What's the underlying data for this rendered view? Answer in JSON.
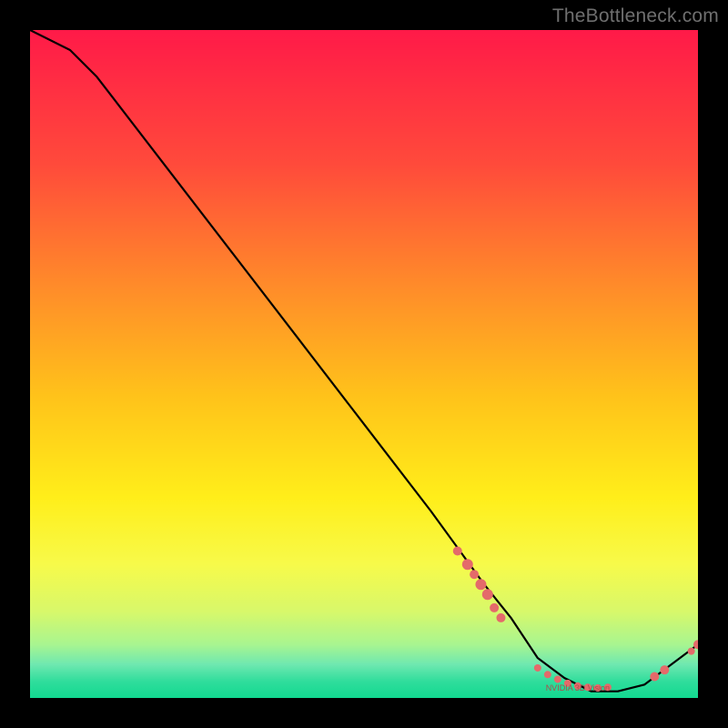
{
  "watermark": "TheBottleneck.com",
  "chart_data": {
    "type": "line",
    "title": "",
    "xlabel": "",
    "ylabel": "",
    "xlim": [
      0,
      100
    ],
    "ylim": [
      0,
      100
    ],
    "grid": false,
    "series": [
      {
        "name": "bottleneck-curve",
        "x": [
          0,
          6,
          10,
          20,
          30,
          40,
          50,
          60,
          68,
          72,
          76,
          80,
          84,
          88,
          92,
          96,
          100
        ],
        "values": [
          100,
          97,
          93,
          80,
          67,
          54,
          41,
          28,
          17,
          12,
          6,
          3,
          1,
          1,
          2,
          5,
          8
        ]
      }
    ],
    "markers": {
      "name": "highlighted-points",
      "color": "#e46a6a",
      "points": [
        {
          "x": 64.0,
          "y": 22.0,
          "r": 5
        },
        {
          "x": 65.5,
          "y": 20.0,
          "r": 6
        },
        {
          "x": 66.5,
          "y": 18.5,
          "r": 5
        },
        {
          "x": 67.5,
          "y": 17.0,
          "r": 6
        },
        {
          "x": 68.5,
          "y": 15.5,
          "r": 6
        },
        {
          "x": 69.5,
          "y": 13.5,
          "r": 5
        },
        {
          "x": 70.5,
          "y": 12.0,
          "r": 5
        },
        {
          "x": 76.0,
          "y": 4.5,
          "r": 4
        },
        {
          "x": 77.5,
          "y": 3.5,
          "r": 4
        },
        {
          "x": 79.0,
          "y": 2.8,
          "r": 4
        },
        {
          "x": 80.5,
          "y": 2.2,
          "r": 4
        },
        {
          "x": 82.0,
          "y": 1.8,
          "r": 4
        },
        {
          "x": 83.5,
          "y": 1.6,
          "r": 4
        },
        {
          "x": 85.0,
          "y": 1.5,
          "r": 4
        },
        {
          "x": 86.5,
          "y": 1.6,
          "r": 4
        },
        {
          "x": 93.5,
          "y": 3.2,
          "r": 5
        },
        {
          "x": 95.0,
          "y": 4.2,
          "r": 5
        },
        {
          "x": 99.0,
          "y": 7.0,
          "r": 4
        },
        {
          "x": 100.0,
          "y": 8.0,
          "r": 5
        }
      ]
    },
    "dense_label": {
      "text": "NVIDIA 3D Vision",
      "x": 82,
      "y": 1.5
    }
  }
}
